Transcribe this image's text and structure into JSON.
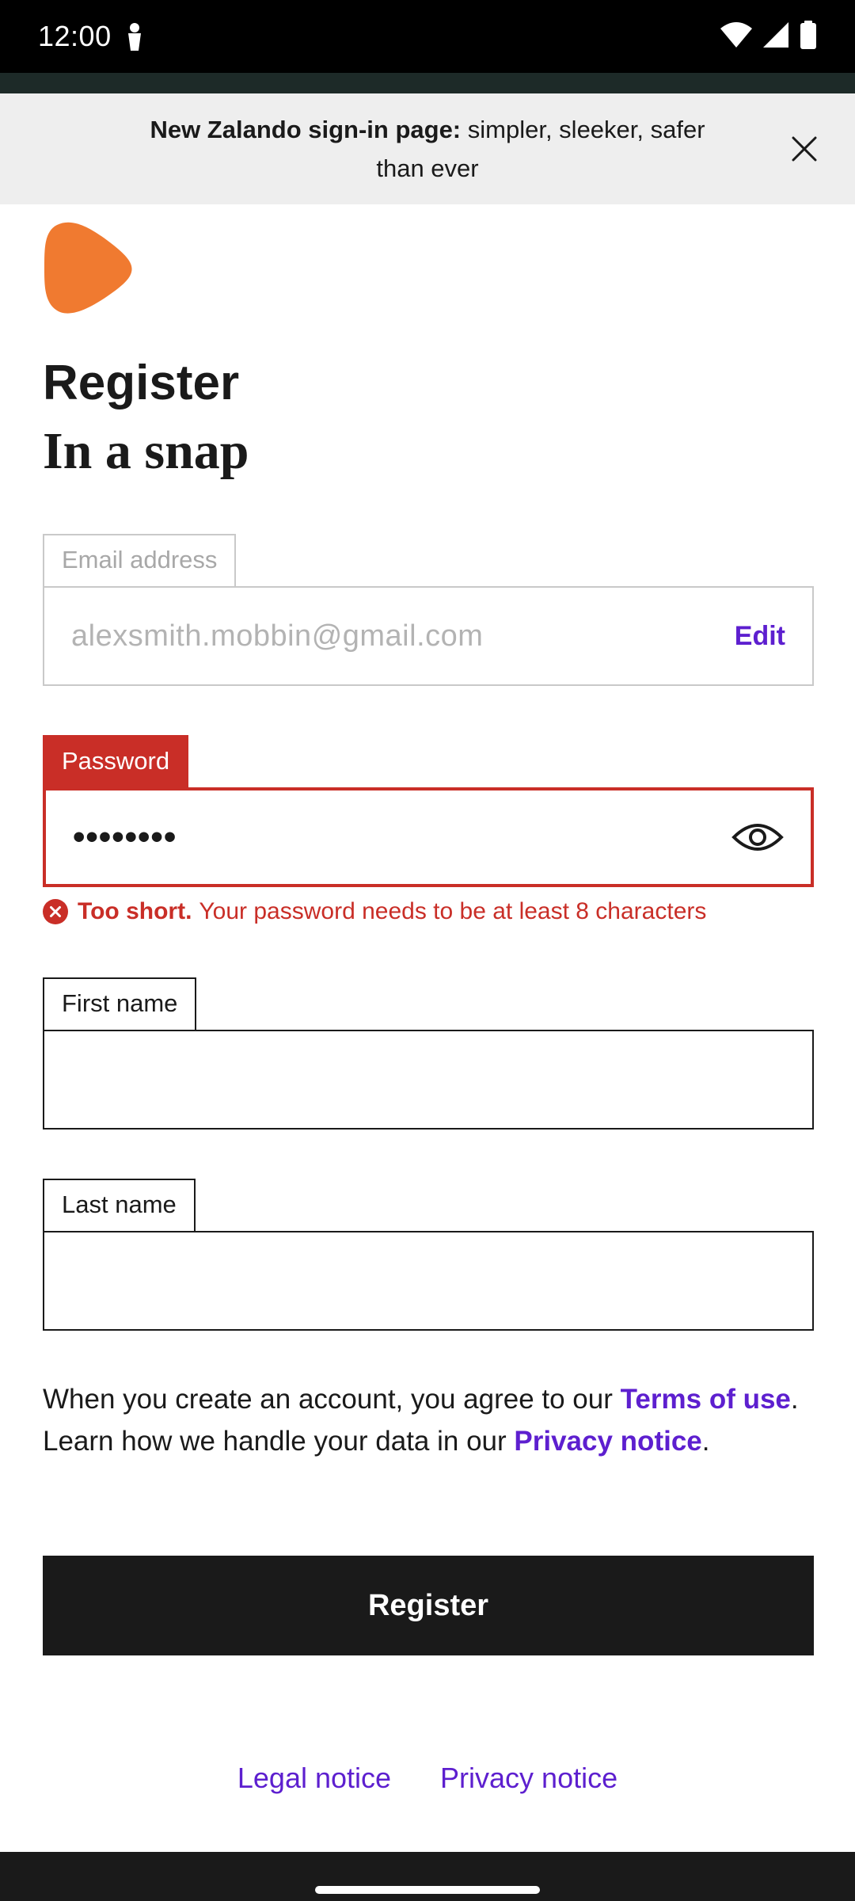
{
  "status_bar": {
    "time": "12:00"
  },
  "banner": {
    "bold_text": "New Zalando sign-in page:",
    "text": "simpler, sleeker, safer than ever"
  },
  "brand": {
    "logo_color": "#f07a30"
  },
  "header": {
    "title": "Register",
    "subtitle": "In a snap"
  },
  "form": {
    "email": {
      "label": "Email address",
      "value": "alexsmith.mobbin@gmail.com",
      "edit_label": "Edit"
    },
    "password": {
      "label": "Password",
      "value": "••••••••",
      "error_strong": "Too short.",
      "error_text": "Your password needs to be at least 8 characters"
    },
    "first_name": {
      "label": "First name",
      "value": ""
    },
    "last_name": {
      "label": "Last name",
      "value": ""
    }
  },
  "legal": {
    "text_1": "When you create an account, you agree to our",
    "terms_link": "Terms of use",
    "text_2": ". Learn how we handle your data in our",
    "privacy_link": "Privacy notice",
    "text_3": "."
  },
  "register_button": {
    "label": "Register"
  },
  "footer": {
    "legal_notice": "Legal notice",
    "privacy_notice": "Privacy notice"
  },
  "colors": {
    "accent": "#5d1fcf",
    "error": "#c92e27",
    "button": "#1a1a1a"
  }
}
